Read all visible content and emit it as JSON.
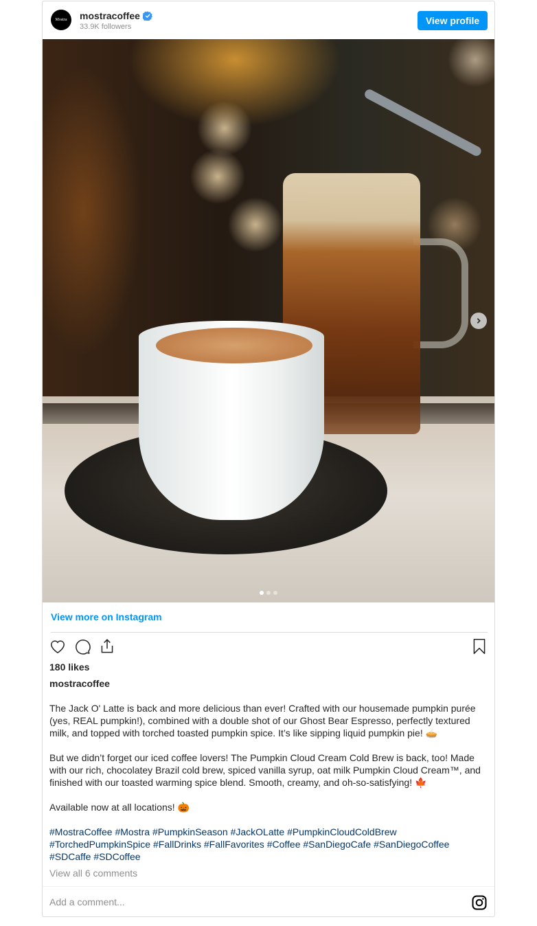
{
  "header": {
    "avatar_text": "Mostra",
    "username": "mostracoffee",
    "verified": true,
    "followers": "33.9K followers",
    "view_profile_label": "View profile"
  },
  "media": {
    "image_description": "Torched pumpkin spice latte in white cup on black saucer with iced cold brew mason jar behind",
    "carousel_count": 3,
    "carousel_active_index": 0,
    "next_icon": "chevron-right-icon"
  },
  "view_more_label": "View more on Instagram",
  "actions": {
    "like_icon": "heart-icon",
    "comment_icon": "comment-icon",
    "share_icon": "share-icon",
    "save_icon": "bookmark-icon"
  },
  "likes": "180 likes",
  "caption": {
    "username": "mostracoffee",
    "paragraphs": [
      "The Jack O' Latte is back and more delicious than ever! Crafted with our housemade pumpkin purée (yes, REAL pumpkin!), combined with a double shot of our Ghost Bear Espresso, perfectly textured milk, and topped with torched toasted pumpkin spice. It’s like sipping liquid pumpkin pie! 🥧",
      "But we didn’t forget our iced coffee lovers! The Pumpkin Cloud Cream Cold Brew is back, too! Made with our rich, chocolatey Brazil cold brew, spiced vanilla syrup, oat milk Pumpkin Cloud Cream™, and finished with our toasted warming spice blend. Smooth, creamy, and oh-so-satisfying! 🍁",
      "Available now at all locations! 🎃"
    ],
    "hashtags": [
      "#MostraCoffee",
      "#Mostra",
      "#PumpkinSeason",
      "#JackOLatte",
      "#PumpkinCloudColdBrew",
      "#TorchedPumpkinSpice",
      "#FallDrinks",
      "#FallFavorites",
      "#Coffee",
      "#SanDiegoCafe",
      "#SanDiegoCoffee",
      "#SDCaffe",
      "#SDCoffee"
    ]
  },
  "view_comments_label": "View all 6 comments",
  "comment": {
    "placeholder": "Add a comment...",
    "value": "",
    "icon": "instagram-icon"
  },
  "colors": {
    "accent": "#0095f6",
    "hashtag": "#00376b",
    "muted": "#8e8e8e",
    "text": "#262626",
    "border": "#dbdbdb"
  }
}
